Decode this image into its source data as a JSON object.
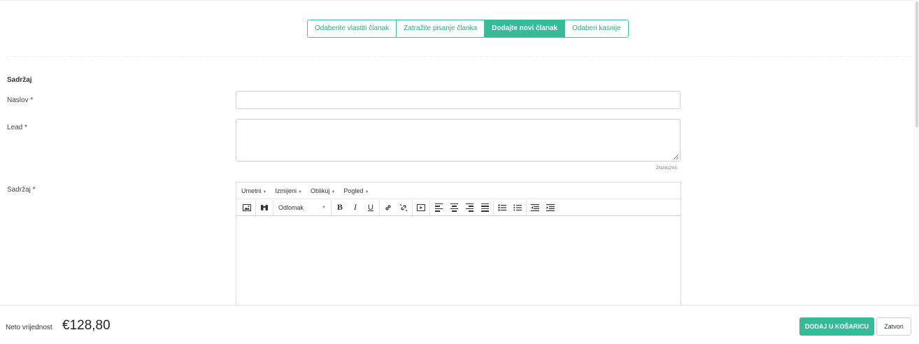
{
  "tabs": [
    {
      "label": "Odaberite vlastiti članak",
      "active": false
    },
    {
      "label": "Zatražite pisanje članka",
      "active": false
    },
    {
      "label": "Dodajte novi članak",
      "active": true
    },
    {
      "label": "Odaberi kasnije",
      "active": false
    }
  ],
  "form": {
    "section_title": "Sadržaj",
    "title_label": "Naslov *",
    "title_value": "",
    "lead_label": "Lead *",
    "lead_value": "",
    "char_counter": "ZNAKOVA:",
    "content_label": "Sadržaj *"
  },
  "editor": {
    "menu": [
      "Umetni",
      "Izmijeni",
      "Oblikuj",
      "Pogled"
    ],
    "format_select": "Odlomak",
    "toolbar_icons": [
      "image-icon",
      "find-replace-icon",
      "bold-icon",
      "italic-icon",
      "underline-icon",
      "link-icon",
      "unlink-icon",
      "media-icon",
      "align-left-icon",
      "align-center-icon",
      "align-right-icon",
      "align-justify-icon",
      "bullet-list-icon",
      "numbered-list-icon",
      "outdent-icon",
      "indent-icon"
    ]
  },
  "footer": {
    "net_label": "Neto vrijednost",
    "net_value": "€128,80",
    "add_to_cart": "DODAJ U KOŠARICU",
    "close": "Zatvori"
  },
  "colors": {
    "accent": "#36bb98",
    "border": "#cfcfcf"
  }
}
